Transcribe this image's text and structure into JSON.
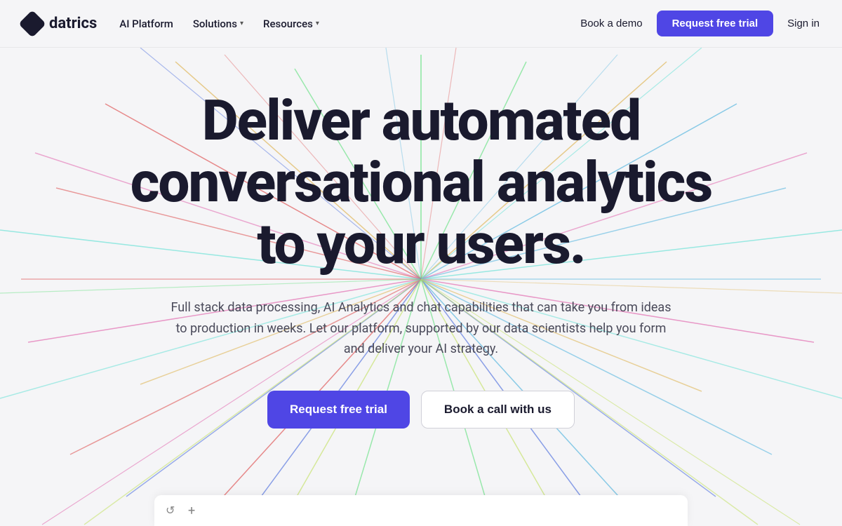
{
  "brand": {
    "name": "datrics"
  },
  "navbar": {
    "links": [
      {
        "label": "AI Platform",
        "has_dropdown": false
      },
      {
        "label": "Solutions",
        "has_dropdown": true
      },
      {
        "label": "Resources",
        "has_dropdown": true
      }
    ],
    "book_demo": "Book a demo",
    "request_trial": "Request free trial",
    "sign_in": "Sign in"
  },
  "hero": {
    "title": "Deliver automated conversational analytics to your users.",
    "subtitle": "Full stack data processing, AI Analytics and chat capabilities that can take you from ideas to production in weeks. Let our platform, supported by our data scientists help you form and deliver your AI strategy.",
    "btn_trial": "Request free trial",
    "btn_call": "Book a call with us"
  },
  "colors": {
    "accent": "#4F46E5",
    "dark": "#1a1a2e",
    "text_muted": "#4a4a5a"
  },
  "lines": {
    "colors": [
      "#e05c5c",
      "#5cb8e0",
      "#5ce07a",
      "#e0b85c",
      "#e05ca8",
      "#5c7ae0",
      "#c0e05c",
      "#5ce0d4"
    ],
    "count": 48
  }
}
